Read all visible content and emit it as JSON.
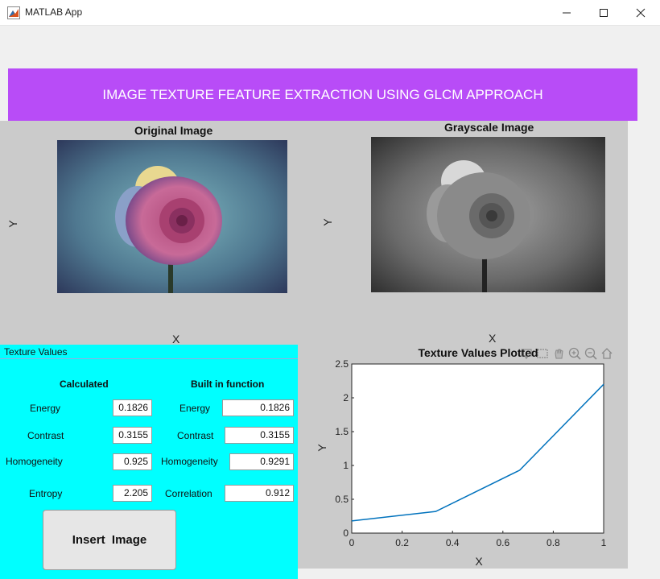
{
  "window": {
    "title": "MATLAB App"
  },
  "colors": {
    "banner": "#b84cf7",
    "panel": "#00ffff",
    "plot_line": "#0072bd",
    "gray_area": "#cbcbcb"
  },
  "banner": {
    "title": "IMAGE TEXTURE FEATURE EXTRACTION USING GLCM APPROACH"
  },
  "axes_original": {
    "title": "Original Image",
    "xlabel": "X",
    "ylabel": "Y"
  },
  "axes_gray": {
    "title": "Grayscale Image",
    "xlabel": "X",
    "ylabel": "Y"
  },
  "panel": {
    "title": "Texture Values",
    "calculated_heading": "Calculated",
    "builtin_heading": "Built in function",
    "calculated": [
      {
        "label": "Energy",
        "value": "0.1826"
      },
      {
        "label": "Contrast",
        "value": "0.3155"
      },
      {
        "label": "Homogeneity",
        "value": "0.925"
      },
      {
        "label": "Entropy",
        "value": "2.205"
      }
    ],
    "builtin": [
      {
        "label": "Energy",
        "value": "0.1826"
      },
      {
        "label": "Contrast",
        "value": "0.3155"
      },
      {
        "label": "Homogeneity",
        "value": "0.9291"
      },
      {
        "label": "Correlation",
        "value": "0.912"
      }
    ],
    "insert_button": "Insert  Image"
  },
  "axes_toolbar": {
    "icons": [
      "data-tips-icon",
      "brush-icon",
      "pan-icon",
      "zoom-in-icon",
      "zoom-out-icon",
      "home-icon"
    ]
  },
  "chart_data": {
    "type": "line",
    "title": "Texture Values Plotted",
    "xlabel": "X",
    "ylabel": "Y",
    "x": [
      0,
      0.3333,
      0.6667,
      1
    ],
    "y": [
      0.18,
      0.32,
      0.93,
      2.2
    ],
    "xlim": [
      0,
      1
    ],
    "ylim": [
      0,
      2.5
    ],
    "xticks": [
      "0",
      "0.2",
      "0.4",
      "0.6",
      "0.8",
      "1"
    ],
    "yticks": [
      "0",
      "0.5",
      "1",
      "1.5",
      "2",
      "2.5"
    ],
    "grid": false
  }
}
